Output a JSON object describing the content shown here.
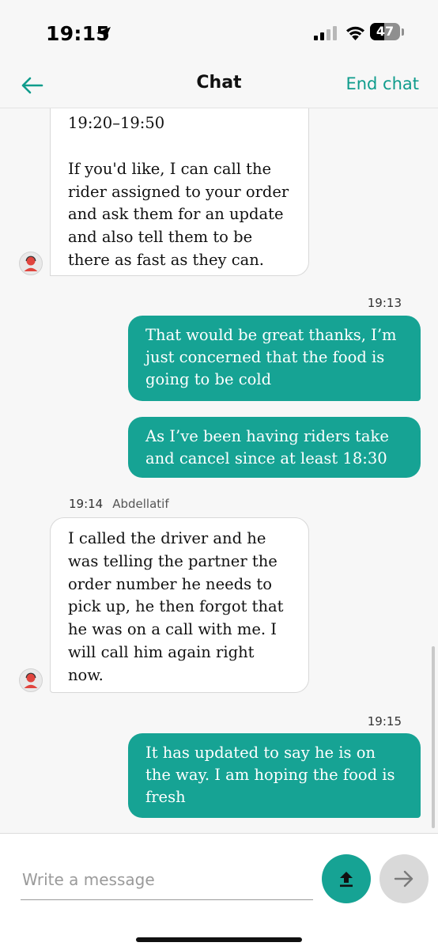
{
  "status_bar": {
    "time": "19:15",
    "battery_level": "47",
    "battery_fraction": 0.47
  },
  "header": {
    "title": "Chat",
    "end_chat_label": "End chat"
  },
  "messages": [
    {
      "direction": "incoming",
      "lines": [
        "19:20–19:50"
      ],
      "lines2": [
        "If you'd like, I can call the",
        "rider assigned to your order",
        "and ask them for an update",
        "and also tell them to be",
        "there as fast as they can."
      ]
    },
    {
      "direction": "outgoing",
      "timestamp": "19:13",
      "lines": [
        "That would be great thanks, I’m",
        "just concerned that the food is",
        "going to be cold"
      ]
    },
    {
      "direction": "outgoing",
      "lines": [
        "As I’ve been having riders take",
        "and cancel since at least 18:30"
      ]
    },
    {
      "direction": "incoming",
      "timestamp": "19:14",
      "agent": "Abdellatif",
      "lines": [
        "I called the driver and he",
        "was telling the partner the",
        "order number he needs to",
        "pick up, he then forgot that",
        "he was on a call with me. I",
        "will call him again right",
        "now."
      ]
    },
    {
      "direction": "outgoing",
      "timestamp": "19:15",
      "lines": [
        "It has updated to say he is on",
        "the way. I am hoping the food is",
        "fresh"
      ]
    }
  ],
  "composer": {
    "placeholder": "Write a message"
  },
  "colors": {
    "accent": "#16a394",
    "accent_text": "#0f9c8c",
    "avatar_red": "#e0453e"
  },
  "icons": [
    "location-arrow-icon",
    "cellular-signal-icon",
    "wifi-icon",
    "battery-icon",
    "back-arrow-icon",
    "agent-avatar-icon",
    "upload-icon",
    "send-arrow-icon"
  ]
}
